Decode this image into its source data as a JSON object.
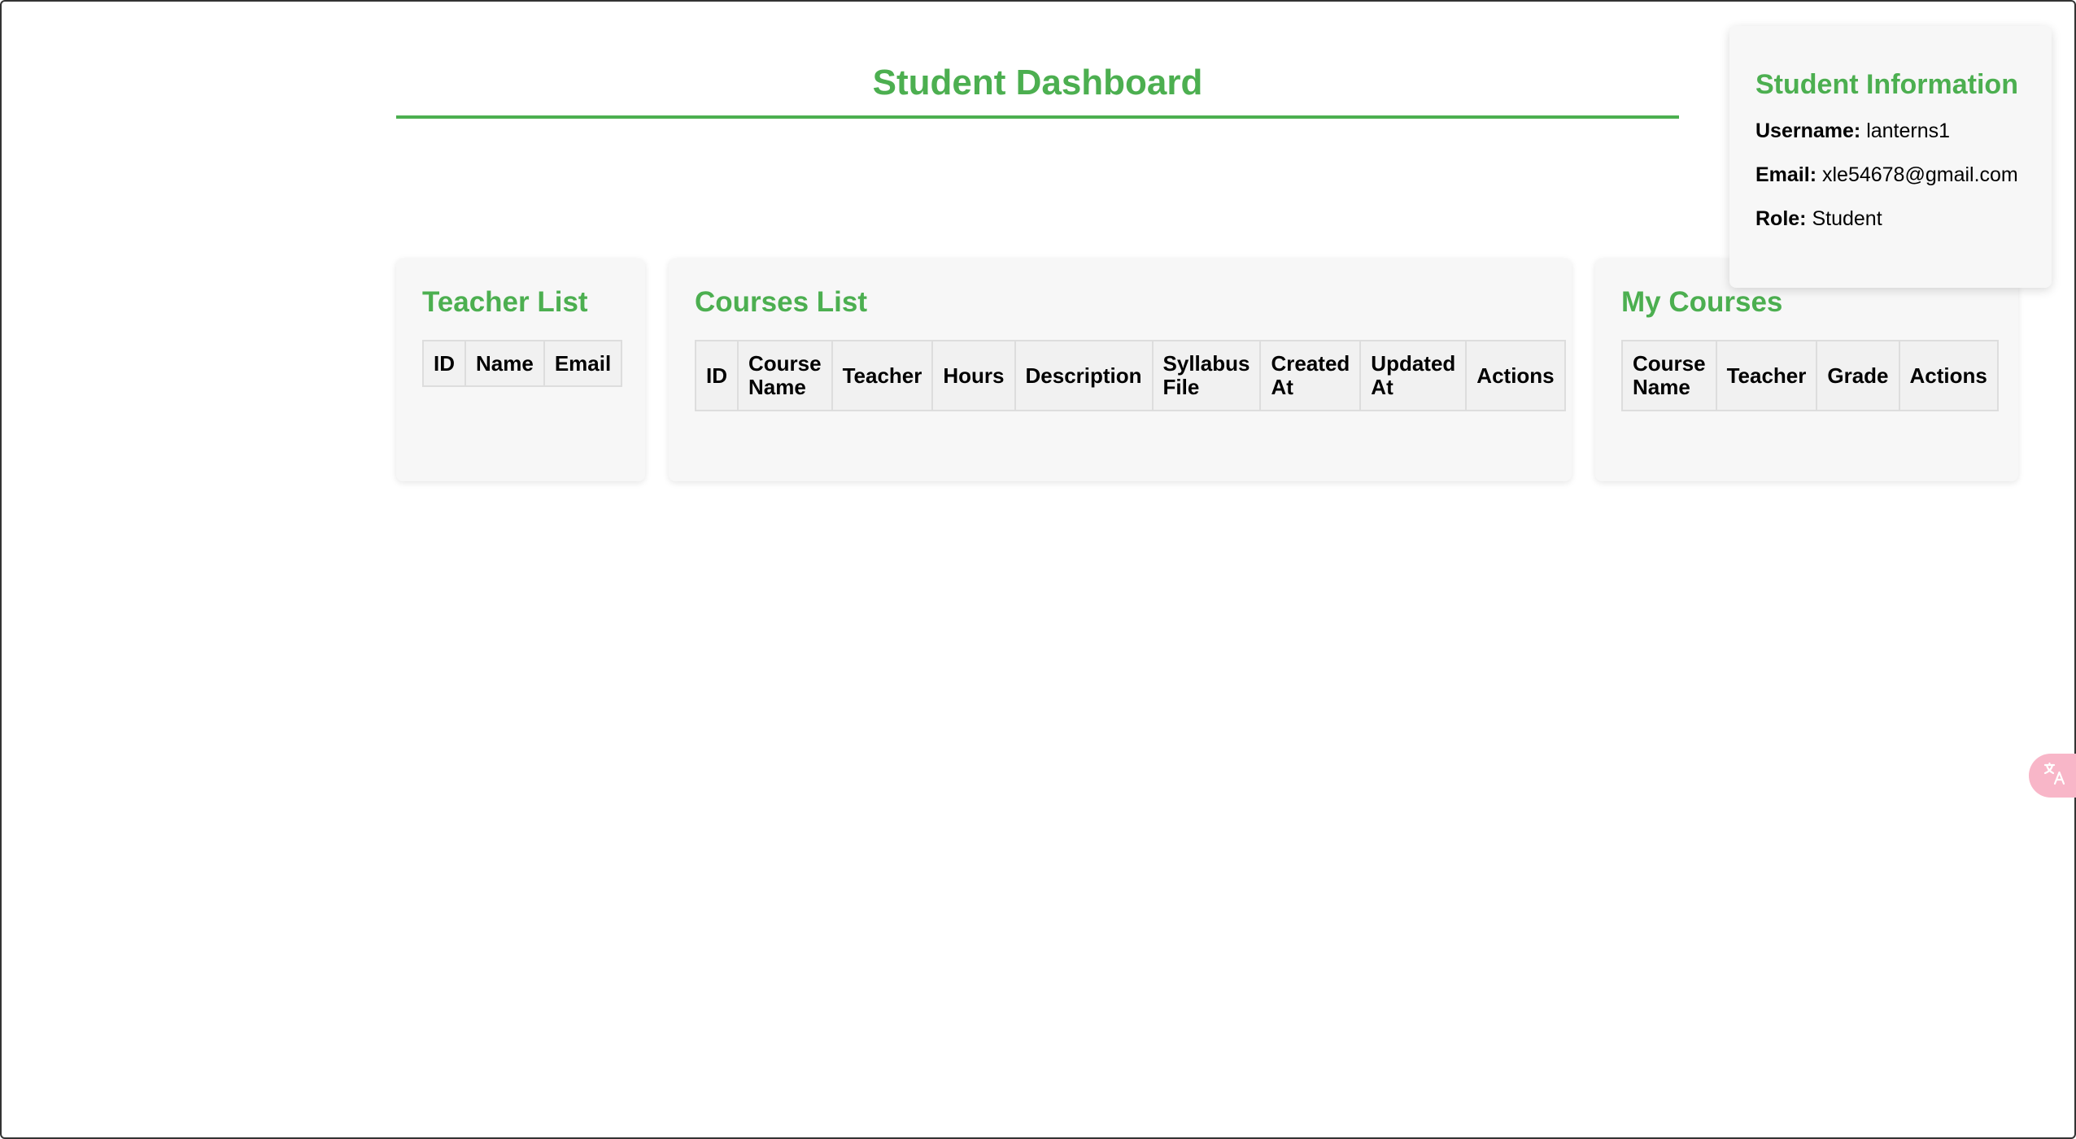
{
  "header": {
    "title": "Student Dashboard"
  },
  "teacher_list": {
    "title": "Teacher List",
    "columns": [
      "ID",
      "Name",
      "Email"
    ],
    "rows": []
  },
  "courses_list": {
    "title": "Courses List",
    "columns": [
      "ID",
      "Course Name",
      "Teacher",
      "Hours",
      "Description",
      "Syllabus File",
      "Created At",
      "Updated At",
      "Actions"
    ],
    "rows": []
  },
  "my_courses": {
    "title": "My Courses",
    "columns": [
      "Course Name",
      "Teacher",
      "Grade",
      "Actions"
    ],
    "rows": []
  },
  "student_info": {
    "title": "Student Information",
    "username_label": "Username:",
    "username": "lanterns1",
    "email_label": "Email:",
    "email": "xle54678@gmail.com",
    "role_label": "Role:",
    "role": "Student"
  },
  "translate_widget": {
    "icon": "translate-icon"
  },
  "colors": {
    "accent": "#4caf50",
    "card_bg": "#f7f7f7",
    "table_header_bg": "#f1f1f1",
    "translate_bg": "#f8b6c8"
  }
}
